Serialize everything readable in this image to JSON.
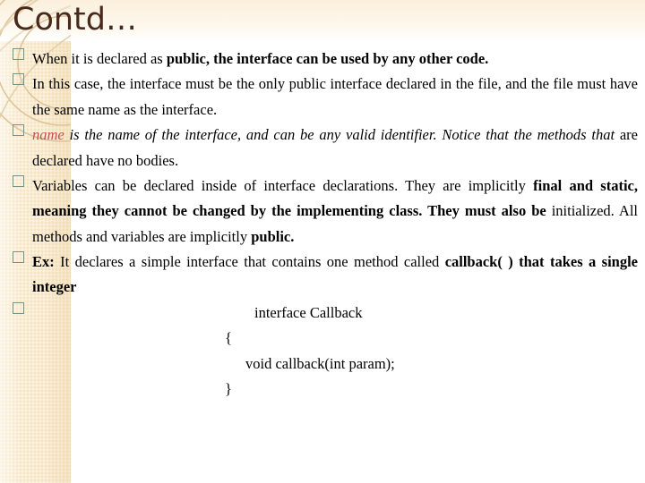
{
  "slide": {
    "title": "Contd…",
    "bullet_glyph": "□",
    "accent_band_color": "#f6e2bb",
    "title_color": "#49291c",
    "marker_color": "#7d9086",
    "highlight_color": "#c0504d"
  },
  "bullets": [
    {
      "marker": "□",
      "segments": [
        {
          "text": "When it is declared as ",
          "style": "normal"
        },
        {
          "text": "public, the interface can be used by any other code.",
          "style": "bold"
        }
      ]
    },
    {
      "marker": "□",
      "segments": [
        {
          "text": "In this case, the interface must be the only public interface declared in the file, and the file must have the same name as the interface.",
          "style": "normal"
        }
      ]
    },
    {
      "marker": "□",
      "segments": [
        {
          "text": "name",
          "style": "italic-highlight"
        },
        {
          "text": " is the name of the interface, and can be any valid identifier. Notice that the methods that",
          "style": "italic"
        },
        {
          "text": " are declared have no bodies.",
          "style": "normal"
        }
      ]
    },
    {
      "marker": "□",
      "segments": [
        {
          "text": "Variables can be declared inside of interface declarations. They are implicitly ",
          "style": "normal"
        },
        {
          "text": "final and static, meaning they cannot be changed by the implementing class. They must also be",
          "style": "bold"
        },
        {
          "text": " initialized. All methods and variables are implicitly ",
          "style": "normal"
        },
        {
          "text": "public.",
          "style": "bold"
        }
      ]
    },
    {
      "marker": "□",
      "segments": [
        {
          "text": "Ex:",
          "style": "bold"
        },
        {
          "text": " It declares a simple interface that contains one method called ",
          "style": "normal"
        },
        {
          "text": "callback( ) that takes a single integer",
          "style": "bold"
        }
      ]
    },
    {
      "marker": "□",
      "segments": []
    }
  ],
  "code": {
    "line1": "interface Callback",
    "line2": "{",
    "line3": "void callback(int param);",
    "line4": "}"
  }
}
